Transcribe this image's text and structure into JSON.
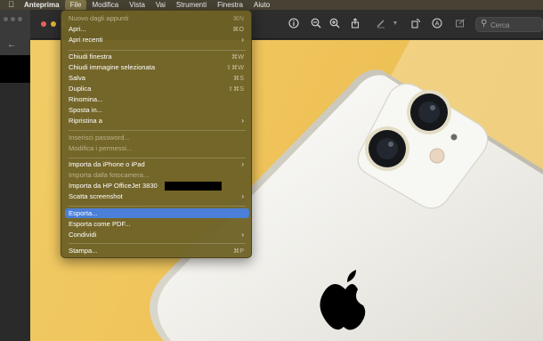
{
  "menubar": {
    "apple_icon": "apple-logo",
    "app_name": "Anteprima",
    "items": [
      "File",
      "Modifica",
      "Vista",
      "Vai",
      "Strumenti",
      "Finestra",
      "Aiuto"
    ],
    "active": "File"
  },
  "toolbar": {
    "search_placeholder": "Cerca",
    "icons": [
      "info-icon",
      "zoom-out-icon",
      "zoom-in-icon",
      "share-icon",
      "markup-pen-icon",
      "rotate-icon",
      "annotate-icon",
      "edit-icon"
    ]
  },
  "file_menu": {
    "items": [
      {
        "label": "Nuovo dagli appunti",
        "shortcut": "⌘N",
        "disabled": true
      },
      {
        "label": "Apri...",
        "shortcut": "⌘O"
      },
      {
        "label": "Apri recenti",
        "submenu": true
      },
      {
        "label": "Chiudi finestra",
        "shortcut": "⌘W"
      },
      {
        "label": "Chiudi immagine selezionata",
        "shortcut": "⇧⌘W"
      },
      {
        "label": "Salva",
        "shortcut": "⌘S"
      },
      {
        "label": "Duplica",
        "shortcut": "⇧⌘S"
      },
      {
        "label": "Rinomina..."
      },
      {
        "label": "Sposta in..."
      },
      {
        "label": "Ripristina a",
        "submenu": true
      },
      {
        "label": "Inserisci password...",
        "disabled": true
      },
      {
        "label": "Modifica i permessi...",
        "disabled": true
      },
      {
        "label": "Importa da iPhone o iPad",
        "submenu": true
      },
      {
        "label": "Importa dalla fotocamera...",
        "disabled": true
      },
      {
        "label": "Importa da HP OfficeJet 3830"
      },
      {
        "label": "Scatta screenshot",
        "submenu": true
      },
      {
        "label": "Esporta...",
        "highlighted": true
      },
      {
        "label": "Esporta come PDF..."
      },
      {
        "label": "Condividi",
        "submenu": true
      },
      {
        "label": "Stampa...",
        "shortcut": "⌘P"
      }
    ],
    "submenu_arrow": "›"
  },
  "colors": {
    "menu_bg": "#6e6226",
    "highlight": "#4b7fd8",
    "photo_bg": "#efc55c",
    "phone_body": "#f0efe9"
  }
}
